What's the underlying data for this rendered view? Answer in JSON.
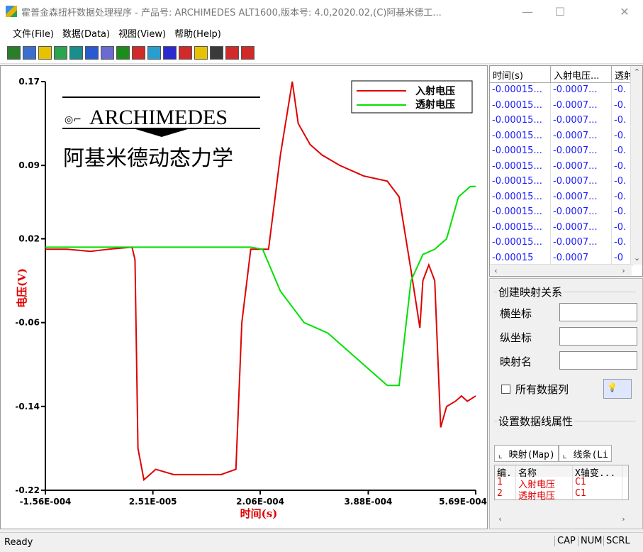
{
  "window": {
    "title": "霍普金森扭杆数据处理程序 - 产品号: ARCHIMEDES ALT1600,版本号: 4.0,2020.02,(C)阿基米德工...",
    "controls": {
      "minimize": "—",
      "maximize": "☐",
      "close": "✕"
    }
  },
  "menu": [
    {
      "label": "文件(File)"
    },
    {
      "label": "数据(Data)"
    },
    {
      "label": "视图(View)"
    },
    {
      "label": "帮助(Help)"
    }
  ],
  "toolbar": {
    "buttons": [
      "open-icon",
      "image-icon",
      "save-icon",
      "refresh-icon",
      "chart-icon",
      "display-icon",
      "window-icon",
      "close-box-icon",
      "eye-icon",
      "globe-icon",
      "list-icon",
      "stop-icon",
      "help-icon",
      "edit-icon",
      "flag-icon",
      "flag2-icon"
    ],
    "colors": [
      "#2a7d2a",
      "#3a6fd0",
      "#e6c200",
      "#2aa44f",
      "#1a8d8d",
      "#2a5ad0",
      "#6a6ad0",
      "#1a8d1a",
      "#d02a2a",
      "#2a9dd0",
      "#2a2ad0",
      "#d02a2a",
      "#e6c200",
      "#3a3a3a",
      "#d02a2a",
      "#d02a2a"
    ]
  },
  "plot": {
    "logo_text": "ARCHIMEDES",
    "logo_subtitle": "阿基米德动态力学",
    "xlabel": "时间(s)",
    "ylabel": "电压(V)",
    "xticks": [
      "-1.56E-004",
      "2.51E-005",
      "2.06E-004",
      "3.88E-004",
      "5.69E-004"
    ],
    "yticks": [
      "0.17",
      "0.09",
      "0.02",
      "-0.06",
      "-0.14",
      "-0.22"
    ],
    "legend": [
      {
        "name": "入射电压",
        "color": "#e00000"
      },
      {
        "name": "透射电压",
        "color": "#00e000"
      }
    ]
  },
  "chart_data": {
    "type": "line",
    "xlabel": "时间(s)",
    "ylabel": "电压(V)",
    "xlim": [
      -0.000156,
      0.000569
    ],
    "ylim": [
      -0.22,
      0.17
    ],
    "grid": false,
    "legend_position": "top-right",
    "series": [
      {
        "name": "入射电压",
        "color": "#e00000",
        "x": [
          -0.000156,
          -0.00012,
          -8e-05,
          -5e-05,
          -1e-05,
          -5e-06,
          0,
          1e-05,
          3e-05,
          6e-05,
          0.0001,
          0.00014,
          0.000165,
          0.000175,
          0.00019,
          0.00022,
          0.00024,
          0.00026,
          0.00027,
          0.00028,
          0.00029,
          0.00031,
          0.00034,
          0.00038,
          0.00042,
          0.00044,
          0.00046,
          0.000475,
          0.00048,
          0.00049,
          0.0005,
          0.00051,
          0.00052,
          0.000535,
          0.000545,
          0.000555,
          0.000569
        ],
        "y": [
          0.01,
          0.01,
          0.008,
          0.01,
          0.012,
          0.0,
          -0.18,
          -0.21,
          -0.2,
          -0.205,
          -0.205,
          -0.205,
          -0.2,
          -0.06,
          0.01,
          0.01,
          0.1,
          0.17,
          0.13,
          0.12,
          0.11,
          0.1,
          0.09,
          0.08,
          0.075,
          0.06,
          -0.01,
          -0.065,
          -0.02,
          -0.005,
          -0.02,
          -0.16,
          -0.14,
          -0.135,
          -0.13,
          -0.135,
          -0.13
        ]
      },
      {
        "name": "透射电压",
        "color": "#00e000",
        "x": [
          -0.000156,
          -0.0001,
          -5e-05,
          0,
          5e-05,
          0.0001,
          0.00015,
          0.00019,
          0.00021,
          0.00024,
          0.00028,
          0.00032,
          0.00036,
          0.0004,
          0.00042,
          0.00044,
          0.00046,
          0.00048,
          0.0005,
          0.00052,
          0.00054,
          0.00056,
          0.000569
        ],
        "y": [
          0.012,
          0.012,
          0.012,
          0.012,
          0.012,
          0.012,
          0.012,
          0.012,
          0.01,
          -0.03,
          -0.06,
          -0.07,
          -0.09,
          -0.11,
          -0.12,
          -0.12,
          -0.02,
          0.005,
          0.01,
          0.02,
          0.06,
          0.07,
          0.07
        ]
      }
    ]
  },
  "grid": {
    "columns": [
      "时间(s)",
      "入射电压...",
      "透射"
    ],
    "rows": [
      [
        "-0.00015...",
        "-0.0007...",
        "-0."
      ],
      [
        "-0.00015...",
        "-0.0007...",
        "-0."
      ],
      [
        "-0.00015...",
        "-0.0007...",
        "-0."
      ],
      [
        "-0.00015...",
        "-0.0007...",
        "-0."
      ],
      [
        "-0.00015...",
        "-0.0007...",
        "-0."
      ],
      [
        "-0.00015...",
        "-0.0007...",
        "-0."
      ],
      [
        "-0.00015...",
        "-0.0007...",
        "-0."
      ],
      [
        "-0.00015...",
        "-0.0007...",
        "-0."
      ],
      [
        "-0.00015...",
        "-0.0007...",
        "-0."
      ],
      [
        "-0.00015...",
        "-0.0007...",
        "-0."
      ],
      [
        "-0.00015...",
        "-0.0007...",
        "-0."
      ],
      [
        "-0.00015",
        "-0.0007",
        "-0"
      ]
    ]
  },
  "mapping": {
    "group_title": "创建映射关系",
    "x_label": "横坐标",
    "y_label": "纵坐标",
    "name_label": "映射名",
    "x_value": "",
    "y_value": "",
    "name_value": "",
    "all_columns_label": "所有数据列",
    "all_columns_checked": false
  },
  "lineprops": {
    "group_title": "设置数据线属性",
    "tabs": [
      "映射(Map)",
      "线条(Li"
    ],
    "columns": [
      "编.",
      "名称",
      "X轴变..."
    ],
    "rows": [
      {
        "id": "1",
        "name": "入射电压",
        "x": "C1"
      },
      {
        "id": "2",
        "name": "透射电压",
        "x": "C1"
      }
    ]
  },
  "status": {
    "text": "Ready",
    "indicators": [
      "CAP",
      "NUM",
      "SCRL"
    ]
  }
}
